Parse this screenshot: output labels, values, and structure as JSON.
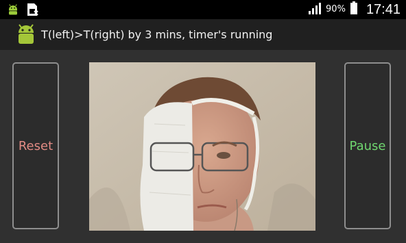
{
  "status_bar": {
    "battery_percent": "90%",
    "time": "17:41",
    "icons": [
      "android-notification-icon",
      "sim-card-icon",
      "signal-icon",
      "battery-icon"
    ]
  },
  "action_bar": {
    "title": "T(left)>T(right) by  3 mins, timer's running",
    "icon": "android-robot-icon"
  },
  "controls": {
    "reset_label": "Reset",
    "pause_label": "Pause"
  },
  "colors": {
    "reset": "#e28b84",
    "pause": "#6fd66f",
    "android_green": "#a4c639"
  }
}
